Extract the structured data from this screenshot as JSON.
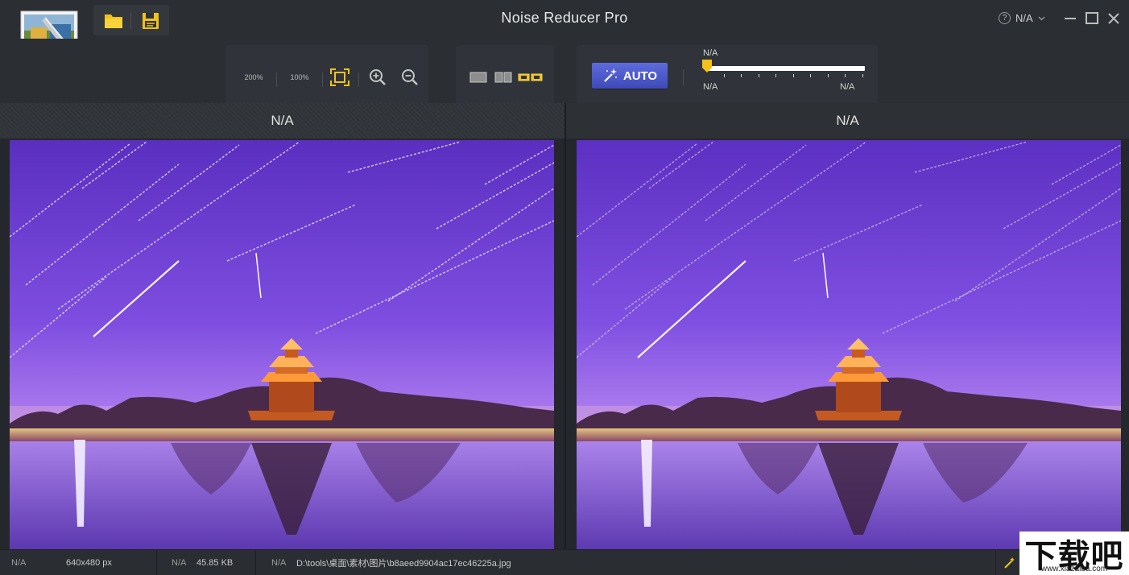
{
  "app": {
    "title": "Noise Reducer Pro"
  },
  "titlebar": {
    "help_label": "N/A"
  },
  "toolbar": {
    "zoom_200": "200%",
    "zoom_100": "100%",
    "auto_label": "AUTO",
    "slider": {
      "top_label": "N/A",
      "min_label": "N/A",
      "max_label": "N/A",
      "value_fraction": 0.0
    }
  },
  "panels": {
    "left_title": "N/A",
    "right_title": "N/A"
  },
  "status": {
    "dims_key": "N/A",
    "dims_value": "640x480 px",
    "size_key": "N/A",
    "size_value": "45.85 KB",
    "path_key": "N/A",
    "path_value": "D:\\tools\\桌面\\素材\\图片\\b8aeed9904ac17ec46225a.jpg"
  },
  "watermark": {
    "main": "下载吧",
    "sub": "www.xiazaiba.com"
  },
  "colors": {
    "accent": "#f2c21b",
    "auto_button": "#4b57c9",
    "bg": "#2b2e33"
  }
}
